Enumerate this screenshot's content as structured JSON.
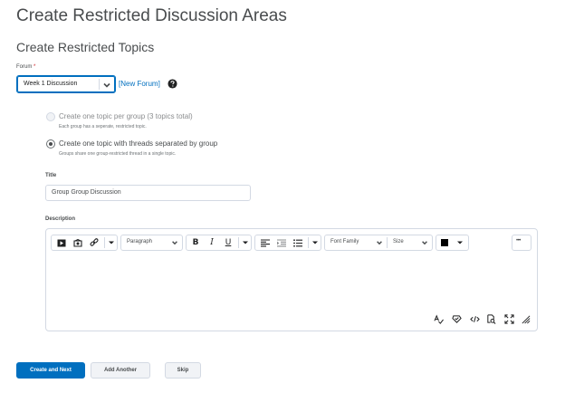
{
  "page": {
    "title": "Create Restricted Discussion Areas",
    "section_title": "Create Restricted Topics"
  },
  "forum": {
    "label": "Forum",
    "required_mark": "*",
    "selected": "Week 1 Discussion",
    "new_forum_link": "[New Forum]"
  },
  "options": [
    {
      "label": "Create one topic per group (3 topics total)",
      "help": "Each group has a seperate, restricted topic.",
      "checked": false
    },
    {
      "label": "Create one topic with threads separated by group",
      "help": "Groups share one group-restricted thread in a single topic.",
      "checked": true
    }
  ],
  "title_field": {
    "label": "Title",
    "value": "Group Group Discussion"
  },
  "description": {
    "label": "Description",
    "toolbar": {
      "paragraph_format": "Paragraph",
      "bold": "B",
      "italic": "I",
      "underline": "U",
      "font_family": "Font Family",
      "font_size": "Size",
      "more": "•••"
    },
    "text_color": "#000000"
  },
  "buttons": {
    "create_next": "Create and Next",
    "add_another": "Add Another",
    "skip": "Skip"
  },
  "colors": {
    "accent": "#006fbf",
    "text": "#494c4e",
    "border": "#d3d9e3"
  }
}
